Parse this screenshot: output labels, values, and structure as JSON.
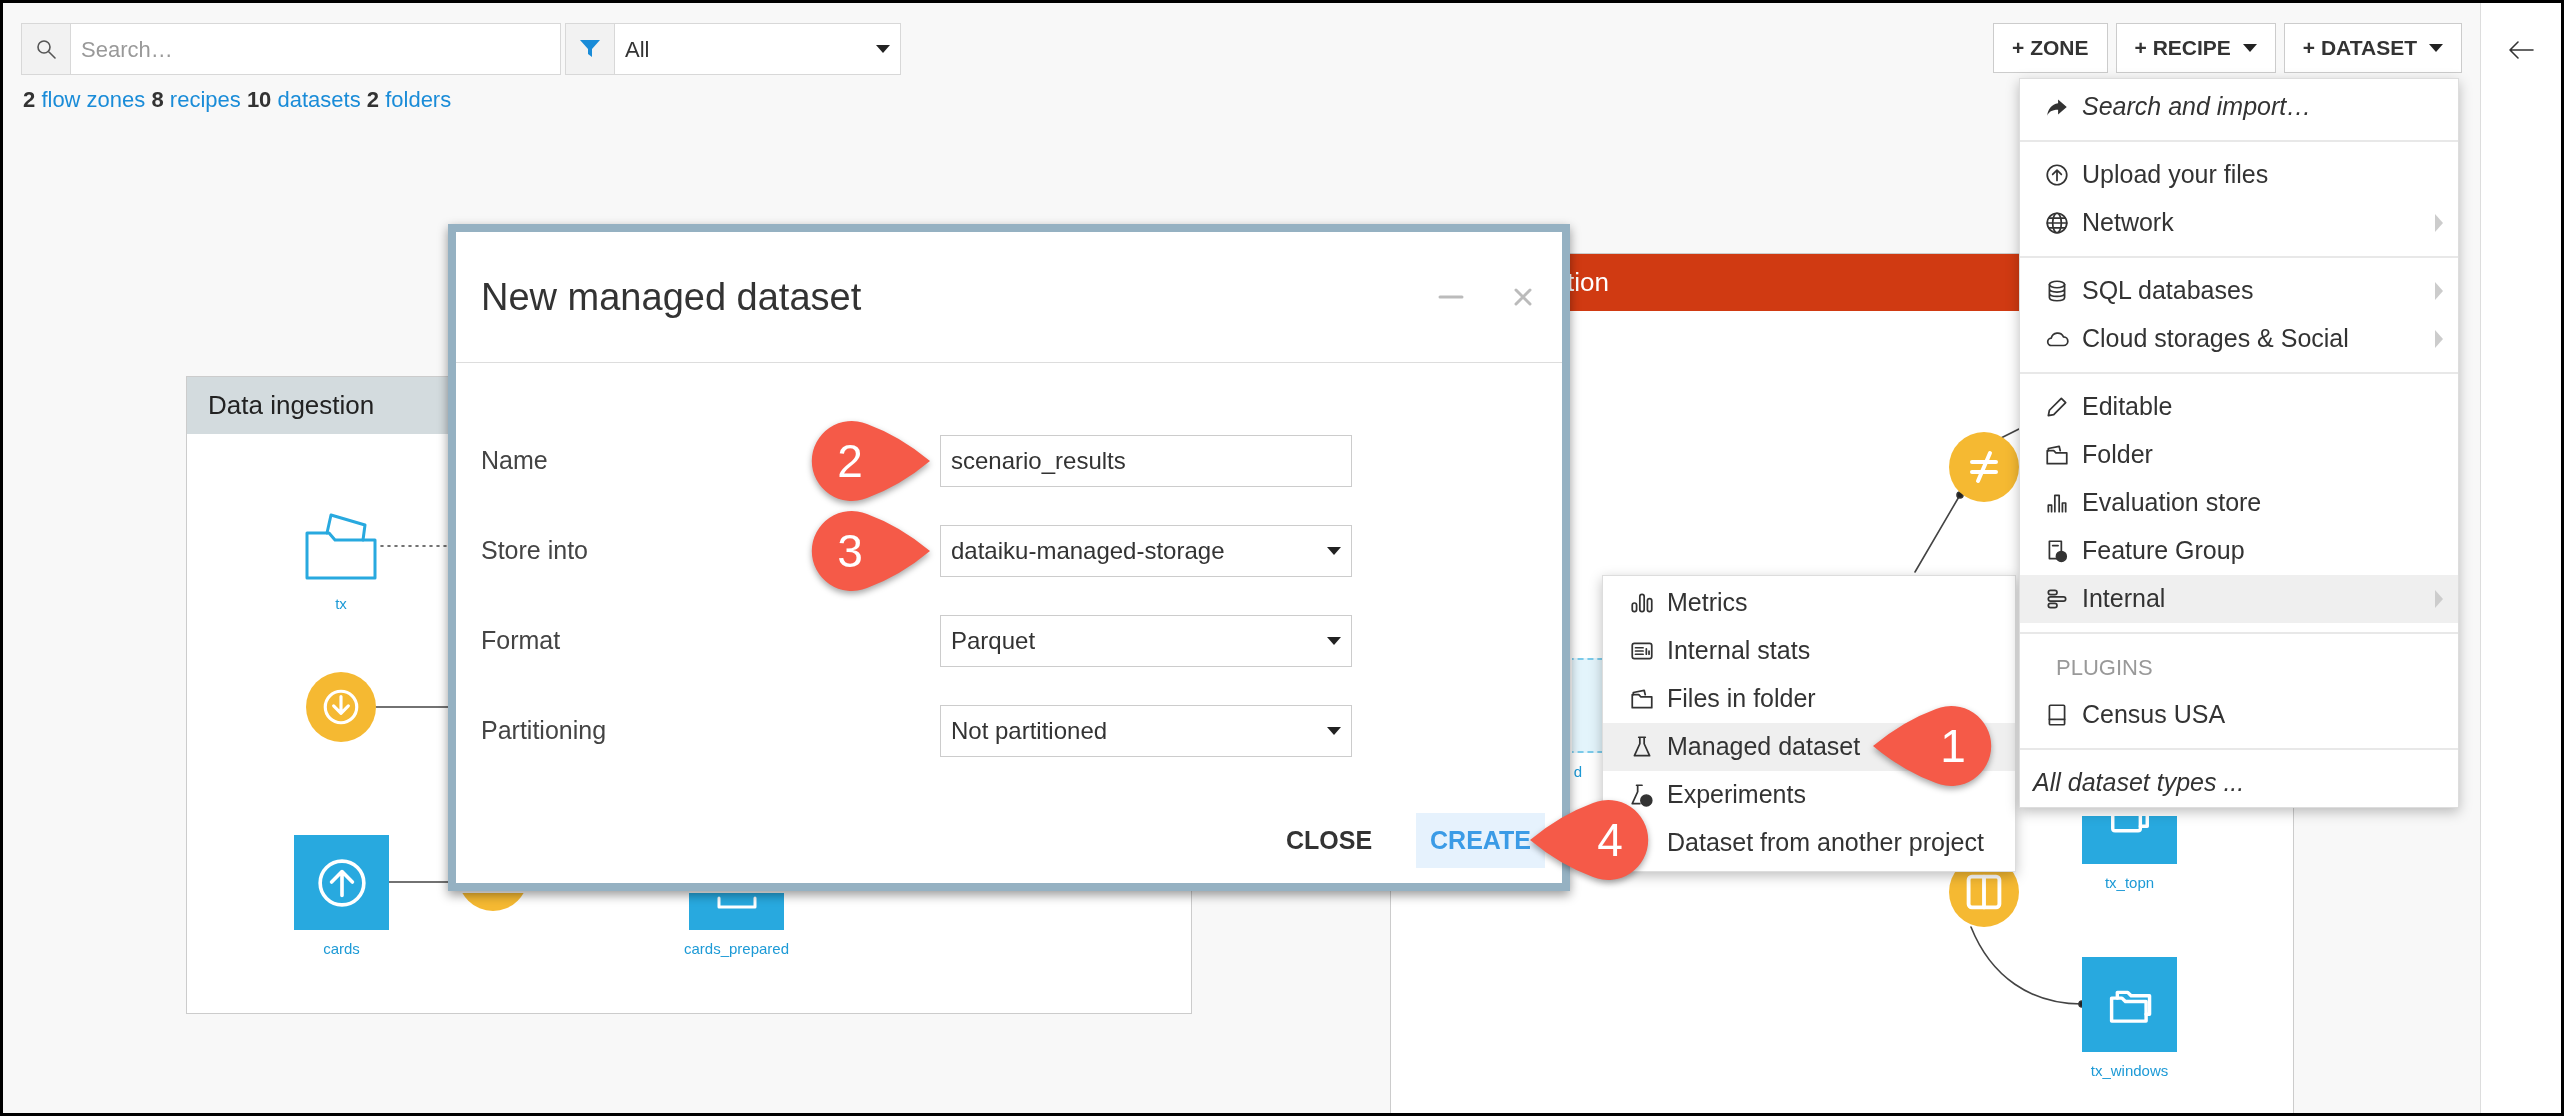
{
  "toolbar": {
    "search": {
      "placeholder": "Search…"
    },
    "filter": {
      "value": "All"
    },
    "counts": [
      {
        "number": "2",
        "label": "flow zones"
      },
      {
        "number": "8",
        "label": "recipes"
      },
      {
        "number": "10",
        "label": "datasets"
      },
      {
        "number": "2",
        "label": "folders"
      }
    ]
  },
  "actions": [
    {
      "label": "+ ZONE",
      "dropdown": false
    },
    {
      "label": "+ RECIPE",
      "dropdown": true
    },
    {
      "label": "+ DATASET",
      "dropdown": true
    }
  ],
  "flow_zones": [
    {
      "title": "Data ingestion",
      "color": "#d3dbde",
      "nodes": [
        {
          "kind": "folder",
          "label": "tx"
        },
        {
          "kind": "recipe"
        },
        {
          "kind": "dataset",
          "label": "cards"
        },
        {
          "kind": "recipe"
        },
        {
          "kind": "dataset",
          "label": "cards_prepared"
        }
      ]
    },
    {
      "title": "tion",
      "color": "#d03a12",
      "nodes": [
        {
          "kind": "virtual_dataset",
          "label": "d"
        },
        {
          "kind": "recipe"
        },
        {
          "kind": "dataset",
          "label": "tx_topn"
        },
        {
          "kind": "recipe"
        },
        {
          "kind": "dataset",
          "label": "tx_windows"
        }
      ]
    }
  ],
  "dialog": {
    "title": "New managed dataset",
    "fields": [
      {
        "label": "Name",
        "kind": "text",
        "value": "scenario_results"
      },
      {
        "label": "Store into",
        "kind": "select",
        "value": "dataiku-managed-storage"
      },
      {
        "label": "Format",
        "kind": "select",
        "value": "Parquet"
      },
      {
        "label": "Partitioning",
        "kind": "select",
        "value": "Not partitioned"
      }
    ],
    "buttons": [
      {
        "label": "CLOSE",
        "kind": "plain"
      },
      {
        "label": "CREATE",
        "kind": "primary"
      }
    ]
  },
  "dataset_menu": [
    {
      "kind": "item",
      "label": "Search and import…",
      "italic": true,
      "submenu": false,
      "selected": false
    },
    {
      "kind": "divider"
    },
    {
      "kind": "item",
      "label": "Upload your files",
      "italic": false,
      "submenu": false,
      "selected": false
    },
    {
      "kind": "item",
      "label": "Network",
      "italic": false,
      "submenu": true,
      "selected": false
    },
    {
      "kind": "divider"
    },
    {
      "kind": "item",
      "label": "SQL databases",
      "italic": false,
      "submenu": true,
      "selected": false
    },
    {
      "kind": "item",
      "label": "Cloud storages & Social",
      "italic": false,
      "submenu": true,
      "selected": false
    },
    {
      "kind": "divider"
    },
    {
      "kind": "item",
      "label": "Editable",
      "italic": false,
      "submenu": false,
      "selected": false
    },
    {
      "kind": "item",
      "label": "Folder",
      "italic": false,
      "submenu": false,
      "selected": false
    },
    {
      "kind": "item",
      "label": "Evaluation store",
      "italic": false,
      "submenu": false,
      "selected": false
    },
    {
      "kind": "item",
      "label": "Feature Group",
      "italic": false,
      "submenu": false,
      "selected": false
    },
    {
      "kind": "item",
      "label": "Internal",
      "italic": false,
      "submenu": true,
      "selected": true
    },
    {
      "kind": "divider"
    },
    {
      "kind": "header",
      "label": "PLUGINS"
    },
    {
      "kind": "item",
      "label": "Census USA",
      "italic": false,
      "submenu": false,
      "selected": false
    },
    {
      "kind": "divider"
    },
    {
      "kind": "item",
      "label": "All dataset types ...",
      "italic": true,
      "submenu": false,
      "selected": false
    }
  ],
  "internal_submenu": [
    {
      "label": "Metrics",
      "selected": false
    },
    {
      "label": "Internal stats",
      "selected": false
    },
    {
      "label": "Files in folder",
      "selected": false
    },
    {
      "label": "Managed dataset",
      "selected": true
    },
    {
      "label": "Experiments",
      "selected": false
    },
    {
      "label": "Dataset from another project",
      "selected": false
    }
  ],
  "callouts": [
    {
      "label": "2",
      "kind": "right_pointer"
    },
    {
      "label": "3",
      "kind": "right_pointer"
    },
    {
      "label": "1",
      "kind": "left_pointer"
    },
    {
      "label": "4",
      "kind": "left_pointer"
    }
  ]
}
